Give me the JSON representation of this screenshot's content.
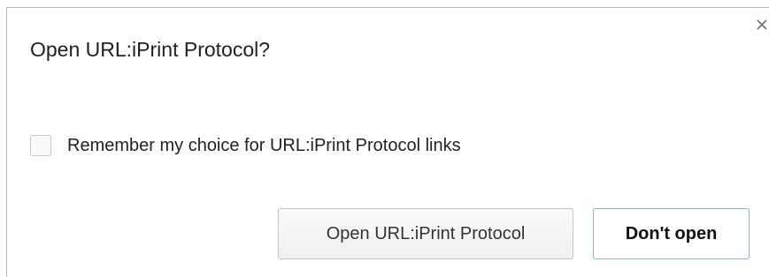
{
  "dialog": {
    "title": "Open URL:iPrint Protocol?",
    "close_icon": "close-icon",
    "remember": {
      "label": "Remember my choice for URL:iPrint Protocol links",
      "checked": false
    },
    "buttons": {
      "open_label": "Open URL:iPrint Protocol",
      "dont_open_label": "Don't open"
    }
  },
  "colors": {
    "border": "#b9b9b9",
    "default_button_border": "#8fb1e6",
    "text": "#222222"
  }
}
